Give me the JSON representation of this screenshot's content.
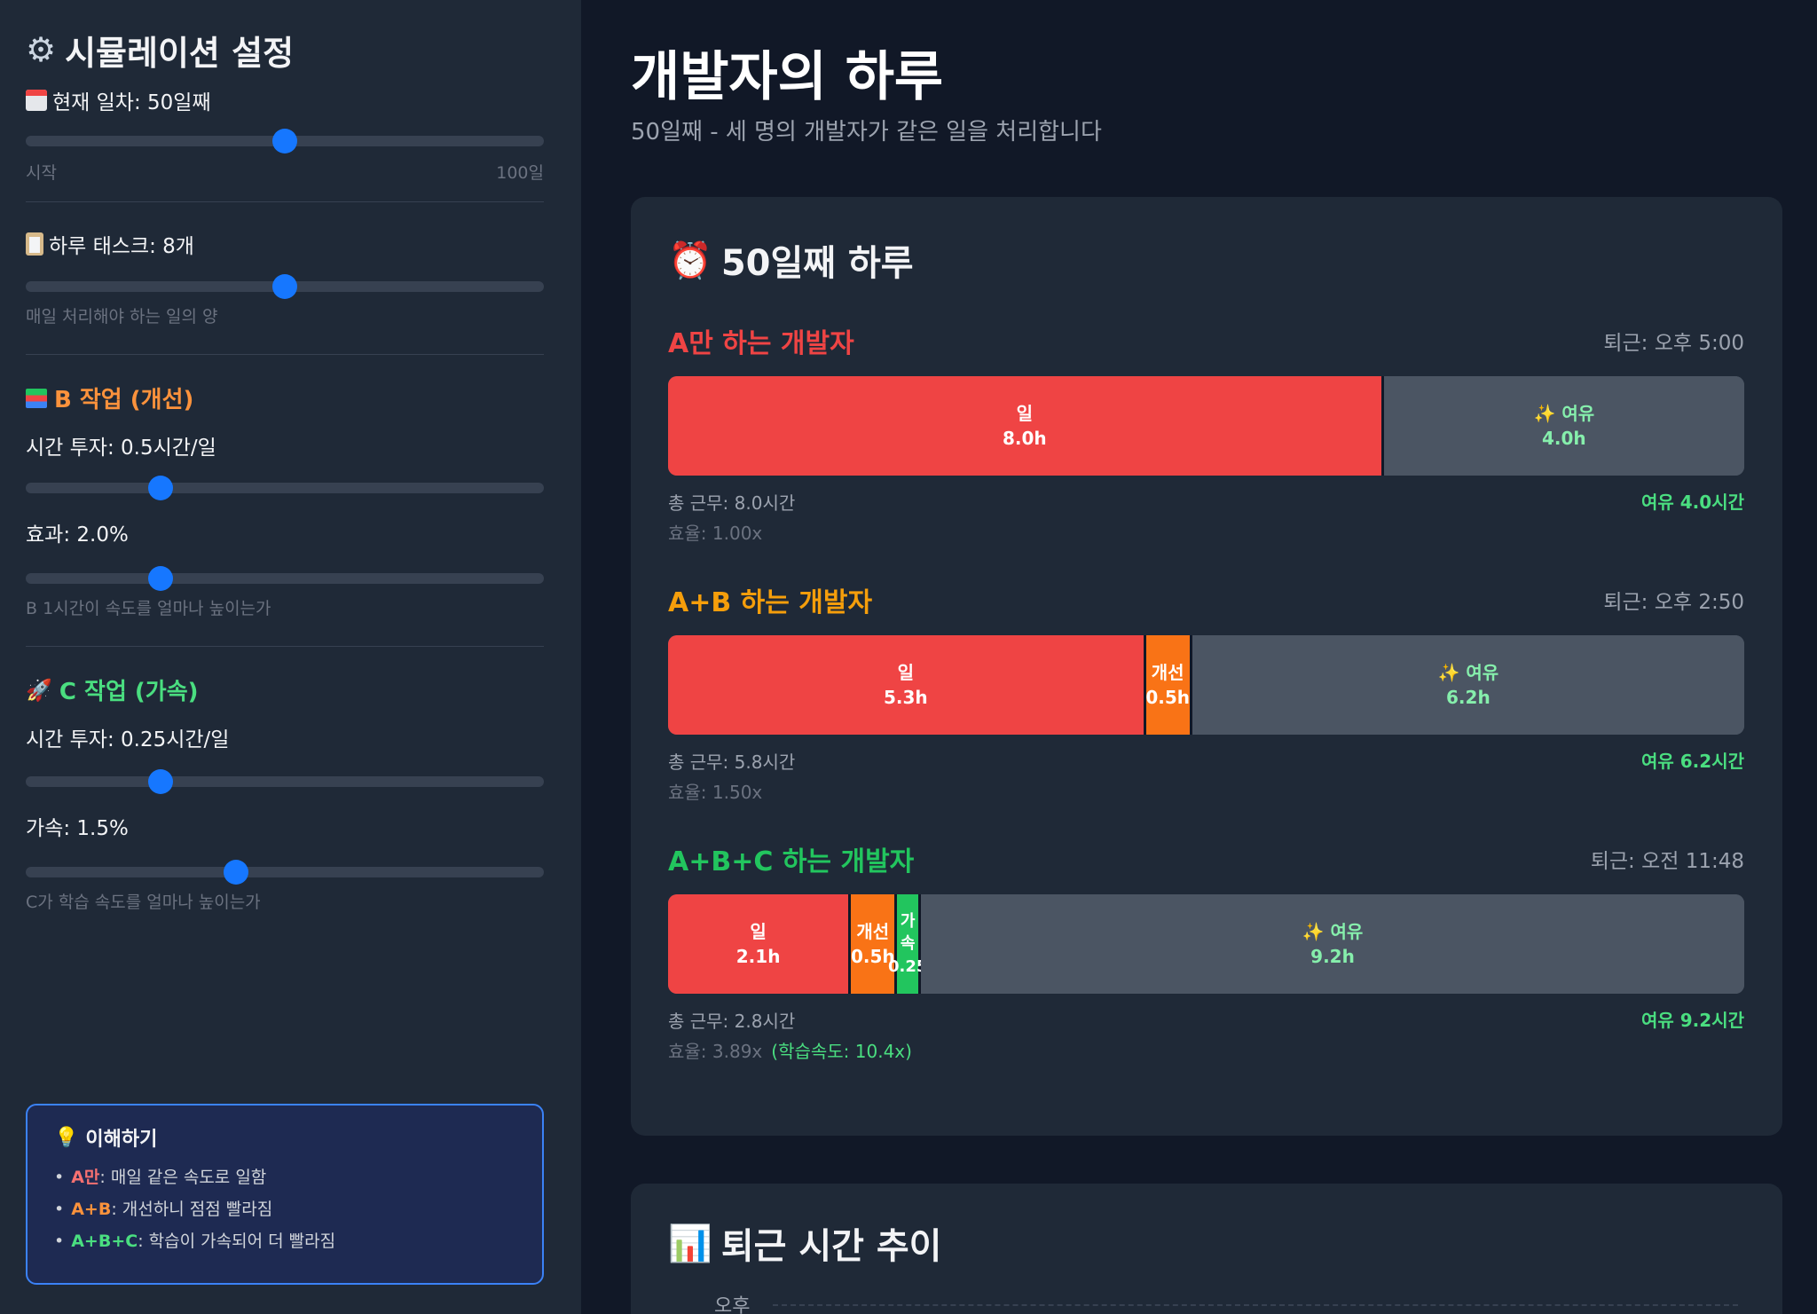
{
  "sidebar": {
    "title": "시뮬레이션 설정",
    "day_label": "현재 일차: 50일째",
    "day_value": 0.5,
    "day_start": "시작",
    "day_end": "100일",
    "tasks_label": "하루 태스크: 8개",
    "tasks_value": 0.5,
    "tasks_hint": "매일 처리해야 하는 일의 양",
    "b_title": "B 작업 (개선)",
    "b_time_label": "시간 투자: 0.5시간/일",
    "b_time_value": 0.26,
    "b_effect_label": "효과: 2.0%",
    "b_effect_value": 0.26,
    "b_hint": "B 1시간이 속도를 얼마나 높이는가",
    "c_title": "C 작업 (가속)",
    "c_time_label": "시간 투자: 0.25시간/일",
    "c_time_value": 0.26,
    "c_accel_label": "가속: 1.5%",
    "c_accel_value": 0.405,
    "c_hint": "C가 학습 속도를 얼마나 높이는가"
  },
  "info": {
    "title": "이해하기",
    "line1_key": "A만",
    "line1_text": ": 매일 같은 속도로 일함",
    "line2_key": "A+B",
    "line2_text": ": 개선하니 점점 빨라짐",
    "line3_key": "A+B+C",
    "line3_text": ": 학습이 가속되어 더 빨라짐"
  },
  "main": {
    "title": "개발자의 하루",
    "subtitle": "50일째 - 세 명의 개발자가 같은 일을 처리합니다"
  },
  "day_card": {
    "title": "50일째 하루",
    "devs": [
      {
        "name": "A만 하는 개발자",
        "leave": "퇴근: 오후 5:00",
        "work_label": "일",
        "work_value": "8.0h",
        "free_label": "✨ 여유",
        "free_value": "4.0h",
        "total": "총 근무: 8.0시간",
        "eff": "효율: 1.00x",
        "spare": "여유 4.0시간"
      },
      {
        "name": "A+B 하는 개발자",
        "leave": "퇴근: 오후 2:50",
        "work_label": "일",
        "work_value": "5.3h",
        "imp_label": "개선",
        "imp_value": "0.5h",
        "free_label": "✨ 여유",
        "free_value": "6.2h",
        "total": "총 근무: 5.8시간",
        "eff": "효율: 1.50x",
        "spare": "여유 6.2시간"
      },
      {
        "name": "A+B+C 하는 개발자",
        "leave": "퇴근: 오전 11:48",
        "work_label": "일",
        "work_value": "2.1h",
        "imp_label": "개선",
        "imp_value": "0.5h",
        "acc_label": "가속",
        "acc_value": "0.25",
        "free_label": "✨ 여유",
        "free_value": "9.2h",
        "total": "총 근무: 2.8시간",
        "eff": "효율: 3.89x",
        "learn": "(학습속도: 10.4x)",
        "spare": "여유 9.2시간"
      }
    ]
  },
  "trend_card": {
    "title": "퇴근 시간 추이",
    "y_label": "오후"
  },
  "colors": {
    "a": "#ef4444",
    "ab": "#f59e0b",
    "abc": "#22c55e",
    "accent": "#1677ff"
  }
}
